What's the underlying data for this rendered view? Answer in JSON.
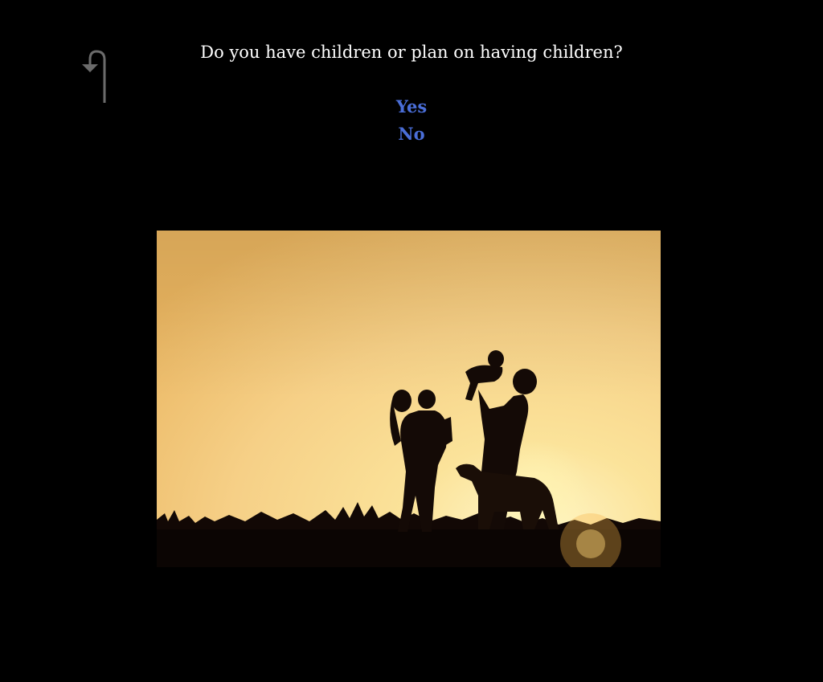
{
  "question": {
    "text": "Do you have children or plan on having children?"
  },
  "options": [
    {
      "label": "Yes"
    },
    {
      "label": "No"
    }
  ],
  "navigation": {
    "back_icon": "back-arrow-icon"
  },
  "photo": {
    "subject": "family-silhouette-at-sunset"
  },
  "colors": {
    "background": "#000000",
    "question_text": "#ffffff",
    "option_link": "#4a6ed8",
    "back_icon": "#6b6b6b",
    "sky_light": "#fbeab0",
    "sky_warm": "#f3bf5e"
  }
}
